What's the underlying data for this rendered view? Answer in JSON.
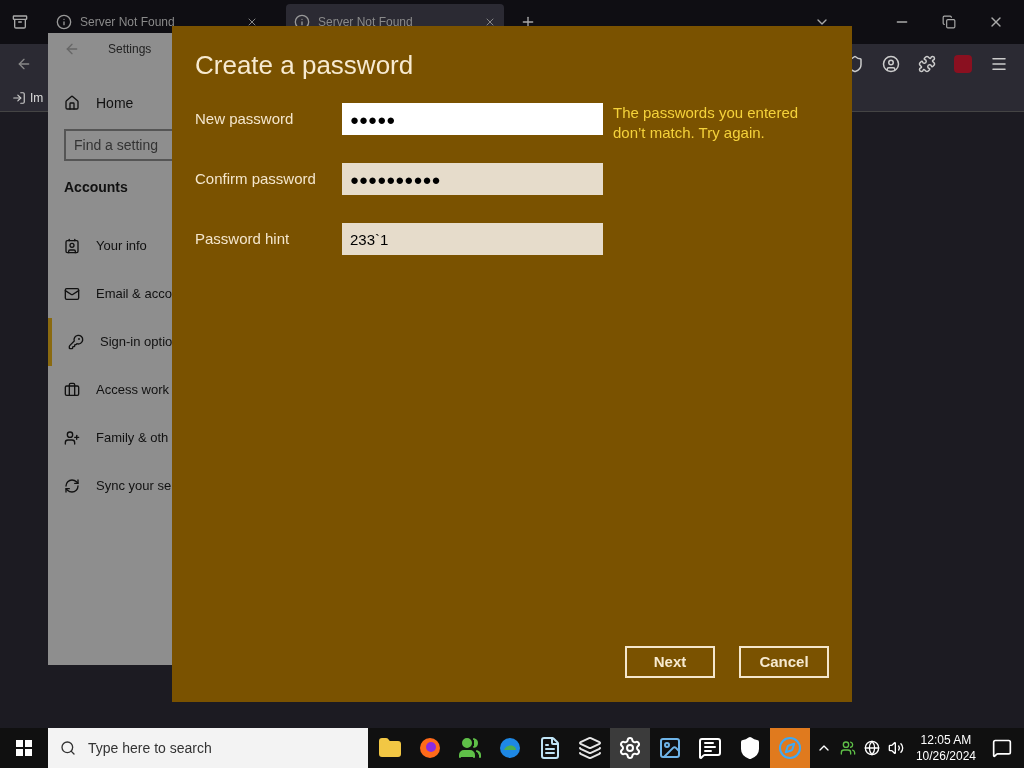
{
  "browser": {
    "tabs": [
      {
        "title": "Server Not Found",
        "selected": false
      },
      {
        "title": "Server Not Found",
        "selected": true
      }
    ],
    "bookmark": "Im"
  },
  "settings": {
    "title": "Settings",
    "home": "Home",
    "search_placeholder": "Find a setting",
    "section": "Accounts",
    "items": [
      {
        "label": "Your info",
        "kind": "info",
        "selected": false
      },
      {
        "label": "Email & acco",
        "kind": "mail",
        "selected": false
      },
      {
        "label": "Sign-in optio",
        "kind": "key",
        "selected": true
      },
      {
        "label": "Access work",
        "kind": "work",
        "selected": false
      },
      {
        "label": "Family & oth",
        "kind": "family",
        "selected": false
      },
      {
        "label": "Sync your se",
        "kind": "sync",
        "selected": false
      }
    ]
  },
  "dialog": {
    "title": "Create a password",
    "fields": [
      {
        "label": "New password",
        "value": "●●●●●",
        "focused": true
      },
      {
        "label": "Confirm password",
        "value": "●●●●●●●●●●",
        "focused": false
      },
      {
        "label": "Password hint",
        "value": "233`1",
        "focused": false
      }
    ],
    "error": "The passwords you entered don’t match. Try again.",
    "buttons": [
      "Next",
      "Cancel"
    ]
  },
  "taskbar": {
    "search_placeholder": "Type here to search",
    "apps": [
      {
        "kind": "folder",
        "active": false,
        "flashing": false
      },
      {
        "kind": "firefox",
        "active": false,
        "flashing": false
      },
      {
        "kind": "people",
        "active": false,
        "flashing": false
      },
      {
        "kind": "edge",
        "active": false,
        "flashing": false
      },
      {
        "kind": "notepad",
        "active": false,
        "flashing": false
      },
      {
        "kind": "windows",
        "active": false,
        "flashing": false
      },
      {
        "kind": "settings",
        "active": true,
        "flashing": false
      },
      {
        "kind": "photo",
        "active": false,
        "flashing": false
      },
      {
        "kind": "chat",
        "active": false,
        "flashing": false
      },
      {
        "kind": "shield",
        "active": false,
        "flashing": false
      },
      {
        "kind": "ie",
        "active": false,
        "flashing": true
      }
    ],
    "time": "12:05 AM",
    "date": "10/26/2024"
  }
}
